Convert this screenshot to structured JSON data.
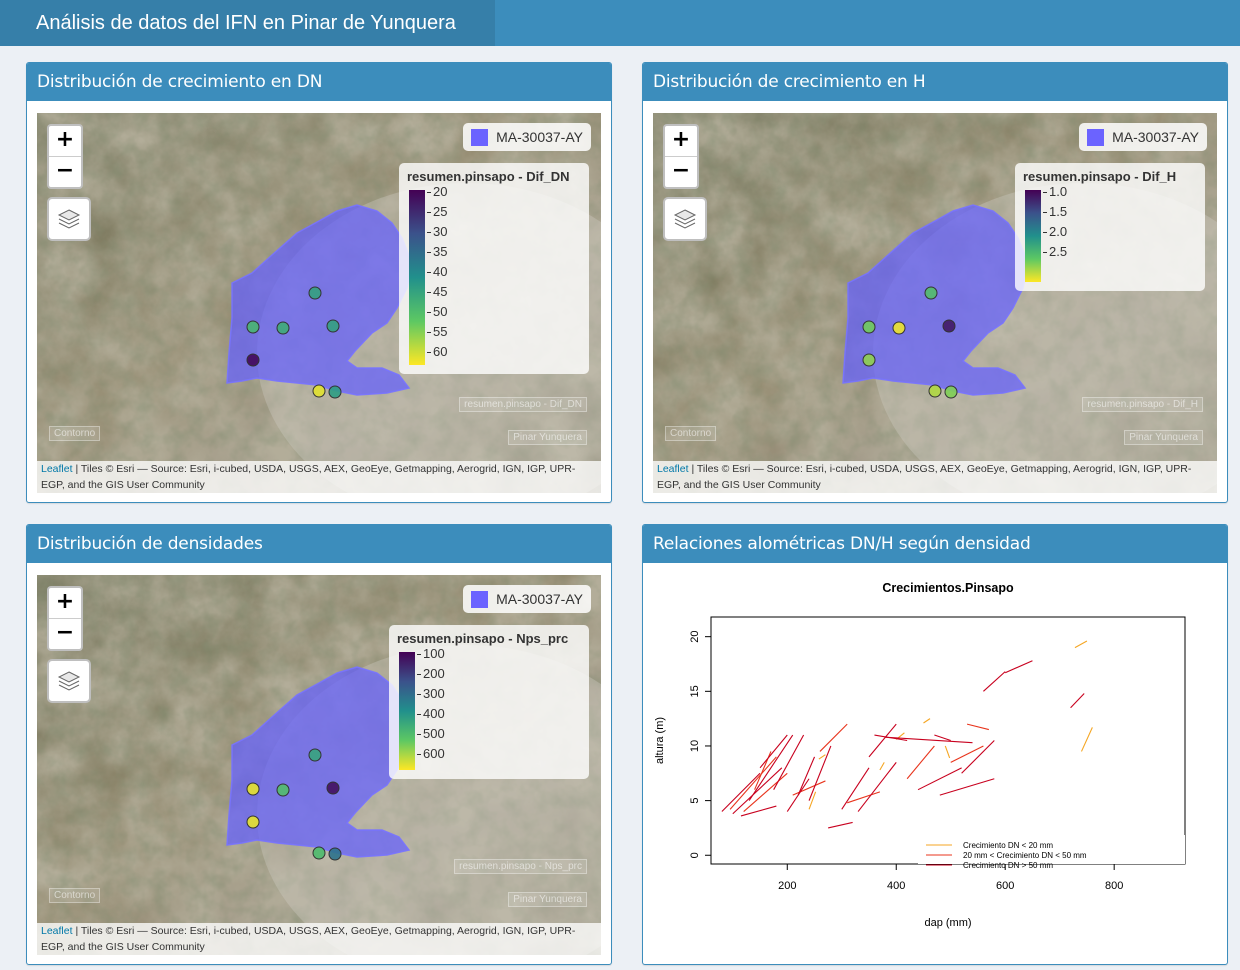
{
  "header": {
    "title": "Análisis de datos del IFN en Pinar de Yunquera"
  },
  "colors": {
    "brand": "#3c8dbc",
    "brand_dark": "#367fa9",
    "overlay": "#6b63ff",
    "viridis": [
      "#440154",
      "#3b528b",
      "#21908c",
      "#5dc863",
      "#fde725"
    ]
  },
  "map_common": {
    "zoom_in": "+",
    "zoom_out": "−",
    "overlay_label": "MA-30037-AY",
    "attribution_link": "Leaflet",
    "attribution_text": " | Tiles © Esri — Source: Esri, i-cubed, USDA, USGS, AEX, GeoEye, Getmapping, Aerogrid, IGN, IGP, UPR-EGP, and the GIS User Community",
    "layer_contorno": "Contorno",
    "layer_pinar": "Pinar Yunquera",
    "icons": [
      "zoom-in-icon",
      "zoom-out-icon",
      "layers-icon"
    ]
  },
  "panels": [
    {
      "title": "Distribución de crecimiento en DN",
      "legend_title": "resumen.pinsapo - Dif_DN",
      "legend_ticks": [
        "20",
        "25",
        "30",
        "35",
        "40",
        "45",
        "50",
        "55",
        "60"
      ],
      "ghost_label": "resumen.pinsapo - Dif_DN",
      "points": [
        {
          "value": 37
        },
        {
          "value": 33
        },
        {
          "value": 35
        },
        {
          "value": 37
        },
        {
          "value": 62
        },
        {
          "value": 20
        },
        {
          "value": 38
        }
      ]
    },
    {
      "title": "Distribución de crecimiento en H",
      "legend_title": "resumen.pinsapo - Dif_H",
      "legend_ticks": [
        "1.0",
        "1.5",
        "2.0",
        "2.5"
      ],
      "ghost_label": "resumen.pinsapo - Dif_H",
      "points": [
        {
          "value": 1.4
        },
        {
          "value": 1.25
        },
        {
          "value": 0.85
        },
        {
          "value": 2.7
        },
        {
          "value": 1.15
        },
        {
          "value": 1.05
        },
        {
          "value": 1.2
        }
      ]
    },
    {
      "title": "Distribución de densidades",
      "legend_title": "resumen.pinsapo - Nps_prc",
      "legend_ticks": [
        "100",
        "200",
        "300",
        "400",
        "500",
        "600"
      ],
      "ghost_label": "resumen.pinsapo - Nps_prc",
      "points": [
        {
          "value": 290
        },
        {
          "value": 60
        },
        {
          "value": 220
        },
        {
          "value": 620
        },
        {
          "value": 60
        },
        {
          "value": 230
        },
        {
          "value": 420
        }
      ]
    }
  ],
  "plot_panel": {
    "title": "Relaciones alométricas DN/H según densidad"
  },
  "chart_data": {
    "type": "line",
    "title": "Crecimientos.Pinsapo",
    "xlabel": "dap (mm)",
    "ylabel": "altura (m)",
    "xlim": [
      60,
      930
    ],
    "ylim": [
      -0.8,
      21.8
    ],
    "xticks": [
      200,
      400,
      600,
      800
    ],
    "yticks": [
      0,
      5,
      10,
      15,
      20
    ],
    "legend_position": "bottom-right",
    "series": [
      {
        "name": "Crecimiento DN < 20 mm",
        "color": "#f5a623",
        "segments": [
          [
            [
              728,
              19.0
            ],
            [
              750,
              19.6
            ]
          ],
          [
            [
              740,
              9.5
            ],
            [
              760,
              11.7
            ]
          ],
          [
            [
              240,
              4.2
            ],
            [
              252,
              5.8
            ]
          ],
          [
            [
              258,
              8.8
            ],
            [
              270,
              9.2
            ]
          ],
          [
            [
              400,
              10.6
            ],
            [
              415,
              11.2
            ]
          ],
          [
            [
              450,
              12.1
            ],
            [
              462,
              12.5
            ]
          ],
          [
            [
              490,
              10.0
            ],
            [
              498,
              8.9
            ]
          ],
          [
            [
              370,
              7.8
            ],
            [
              378,
              8.5
            ]
          ]
        ]
      },
      {
        "name": "20 mm < Crecimiento DN < 50 mm",
        "color": "#e8341c",
        "segments": [
          [
            [
              95,
              4.2
            ],
            [
              180,
              9.0
            ]
          ],
          [
            [
              120,
              4.0
            ],
            [
              200,
              7.5
            ]
          ],
          [
            [
              140,
              6.0
            ],
            [
              170,
              9.5
            ]
          ],
          [
            [
              210,
              5.5
            ],
            [
              270,
              6.8
            ]
          ],
          [
            [
              260,
              9.5
            ],
            [
              310,
              12.0
            ]
          ],
          [
            [
              310,
              4.8
            ],
            [
              370,
              5.8
            ]
          ],
          [
            [
              420,
              7.0
            ],
            [
              470,
              10.0
            ]
          ],
          [
            [
              500,
              8.5
            ],
            [
              560,
              10.0
            ]
          ],
          [
            [
              530,
              12.0
            ],
            [
              570,
              11.5
            ]
          ]
        ]
      },
      {
        "name": "Crecimiento DN > 50 mm",
        "color": "#c8001e",
        "segments": [
          [
            [
              80,
              4.0
            ],
            [
              150,
              7.5
            ]
          ],
          [
            [
              100,
              3.8
            ],
            [
              190,
              8.0
            ]
          ],
          [
            [
              115,
              3.6
            ],
            [
              180,
              4.5
            ]
          ],
          [
            [
              130,
              5.0
            ],
            [
              210,
              11.0
            ]
          ],
          [
            [
              150,
              8.0
            ],
            [
              200,
              11.0
            ]
          ],
          [
            [
              175,
              6.0
            ],
            [
              230,
              11.0
            ]
          ],
          [
            [
              200,
              4.0
            ],
            [
              240,
              7.0
            ]
          ],
          [
            [
              220,
              5.5
            ],
            [
              250,
              9.0
            ]
          ],
          [
            [
              240,
              5.0
            ],
            [
              280,
              10.0
            ]
          ],
          [
            [
              275,
              2.5
            ],
            [
              320,
              3.0
            ]
          ],
          [
            [
              300,
              4.2
            ],
            [
              350,
              8.0
            ]
          ],
          [
            [
              330,
              4.0
            ],
            [
              400,
              8.5
            ]
          ],
          [
            [
              350,
              9.0
            ],
            [
              400,
              12.0
            ]
          ],
          [
            [
              360,
              11.0
            ],
            [
              420,
              10.5
            ]
          ],
          [
            [
              380,
              10.8
            ],
            [
              540,
              10.3
            ]
          ],
          [
            [
              440,
              6.0
            ],
            [
              520,
              8.0
            ]
          ],
          [
            [
              470,
              11.0
            ],
            [
              500,
              10.5
            ]
          ],
          [
            [
              480,
              5.5
            ],
            [
              580,
              7.0
            ]
          ],
          [
            [
              520,
              7.5
            ],
            [
              580,
              10.5
            ]
          ],
          [
            [
              560,
              15.0
            ],
            [
              600,
              16.8
            ]
          ],
          [
            [
              600,
              16.7
            ],
            [
              650,
              17.8
            ]
          ],
          [
            [
              720,
              13.5
            ],
            [
              745,
              14.8
            ]
          ]
        ]
      }
    ]
  }
}
